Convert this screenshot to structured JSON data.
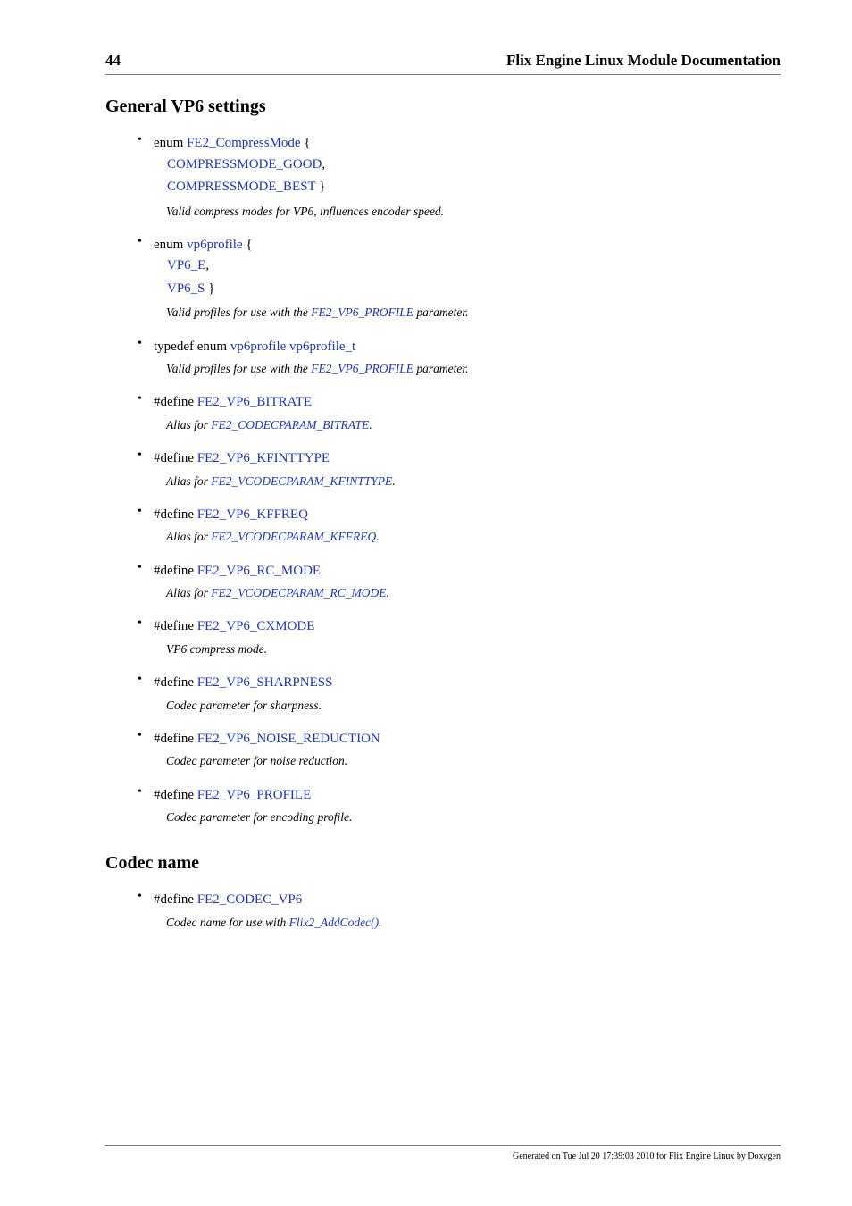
{
  "header": {
    "page_number": "44",
    "doc_title": "Flix Engine Linux Module Documentation"
  },
  "section1": {
    "title": "General VP6 settings",
    "items": [
      {
        "prefix": "enum ",
        "line1_link": "FE2_CompressMode",
        "line1_suffix": " {",
        "line2_link": "COMPRESSMODE_GOOD",
        "line2_suffix": ",",
        "line3_link": "COMPRESSMODE_BEST",
        "line3_suffix": " }",
        "desc": "Valid compress modes for VP6, influences encoder speed."
      },
      {
        "prefix": "enum ",
        "line1_link": "vp6profile",
        "line1_suffix": " {",
        "line2_link": "VP6_E",
        "line2_suffix": ",",
        "line3_link": "VP6_S",
        "line3_suffix": " }",
        "desc_pre": "Valid profiles for use with the ",
        "desc_link": "FE2_VP6_PROFILE",
        "desc_post": " parameter."
      },
      {
        "prefix": "typedef enum ",
        "link_a": "vp6profile",
        "mid": " ",
        "link_b": "vp6profile_t",
        "desc_pre": "Valid profiles for use with the ",
        "desc_link": "FE2_VP6_PROFILE",
        "desc_post": " parameter."
      },
      {
        "prefix": "#define ",
        "link": "FE2_VP6_BITRATE",
        "desc_pre": "Alias for ",
        "desc_link": "FE2_CODECPARAM_BITRATE",
        "desc_post": "."
      },
      {
        "prefix": "#define ",
        "link": "FE2_VP6_KFINTTYPE",
        "desc_pre": "Alias for ",
        "desc_link": "FE2_VCODECPARAM_KFINTTYPE",
        "desc_post": "."
      },
      {
        "prefix": "#define ",
        "link": "FE2_VP6_KFFREQ",
        "desc_pre": "Alias for ",
        "desc_link": "FE2_VCODECPARAM_KFFREQ",
        "desc_post": "."
      },
      {
        "prefix": "#define ",
        "link": "FE2_VP6_RC_MODE",
        "desc_pre": "Alias for ",
        "desc_link": "FE2_VCODECPARAM_RC_MODE",
        "desc_post": "."
      },
      {
        "prefix": "#define ",
        "link": "FE2_VP6_CXMODE",
        "desc": "VP6 compress mode."
      },
      {
        "prefix": "#define ",
        "link": "FE2_VP6_SHARPNESS",
        "desc": "Codec parameter for sharpness."
      },
      {
        "prefix": "#define ",
        "link": "FE2_VP6_NOISE_REDUCTION",
        "desc": "Codec parameter for noise reduction."
      },
      {
        "prefix": "#define ",
        "link": "FE2_VP6_PROFILE",
        "desc": "Codec parameter for encoding profile."
      }
    ]
  },
  "section2": {
    "title": "Codec name",
    "items": [
      {
        "prefix": "#define ",
        "link": "FE2_CODEC_VP6",
        "desc_pre": "Codec name for use with ",
        "desc_link": "Flix2_AddCodec()",
        "desc_post": "."
      }
    ]
  },
  "footer": "Generated on Tue Jul 20 17:39:03 2010 for Flix Engine Linux by Doxygen"
}
